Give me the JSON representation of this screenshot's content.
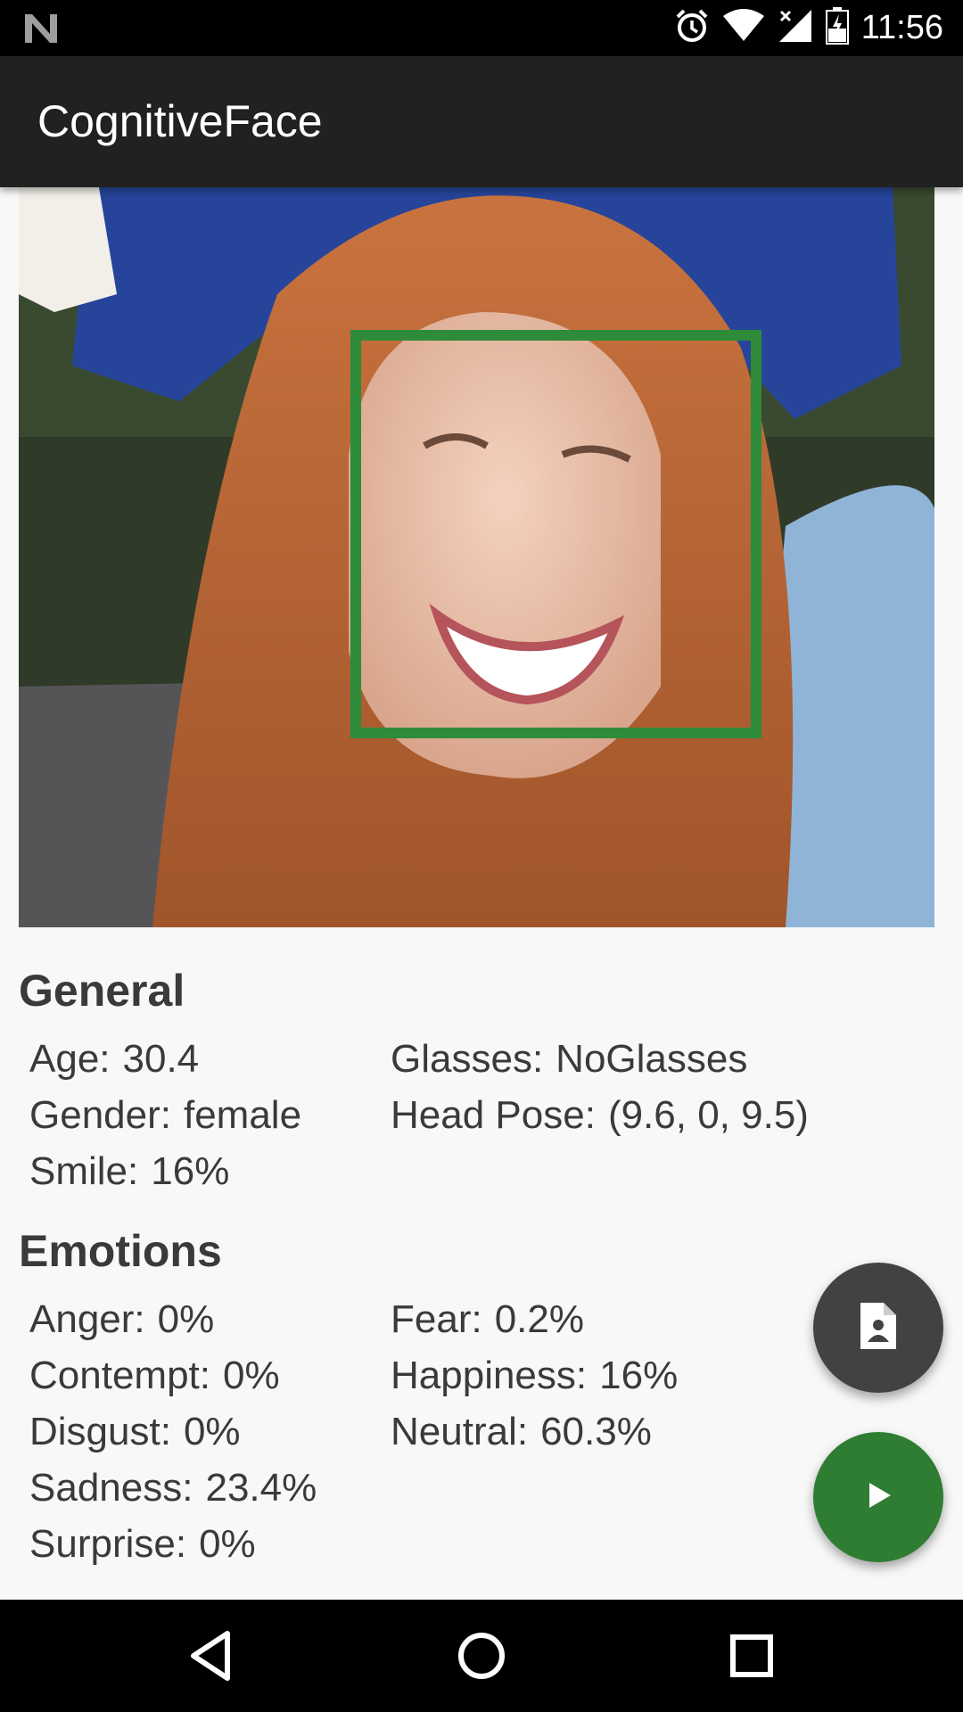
{
  "status_bar": {
    "time": "11:56",
    "icons": [
      "n-notification-icon",
      "alarm-icon",
      "wifi-icon",
      "signal-icon",
      "battery-icon"
    ]
  },
  "app_bar": {
    "title": "CognitiveFace"
  },
  "photo": {
    "description_icon": "face-photo"
  },
  "general": {
    "title": "General",
    "left": [
      {
        "label": "Age:",
        "value": "30.4"
      },
      {
        "label": "Gender:",
        "value": "female"
      },
      {
        "label": "Smile:",
        "value": "16%"
      }
    ],
    "right": [
      {
        "label": "Glasses:",
        "value": "NoGlasses"
      },
      {
        "label": "Head Pose:",
        "value": "(9.6, 0, 9.5)"
      }
    ]
  },
  "emotions": {
    "title": "Emotions",
    "left": [
      {
        "label": "Anger:",
        "value": "0%"
      },
      {
        "label": "Contempt:",
        "value": "0%"
      },
      {
        "label": "Disgust:",
        "value": "0%"
      },
      {
        "label": "Sadness:",
        "value": "23.4%"
      },
      {
        "label": "Surprise:",
        "value": "0%"
      }
    ],
    "right": [
      {
        "label": "Fear:",
        "value": "0.2%"
      },
      {
        "label": "Happiness:",
        "value": "16%"
      },
      {
        "label": "Neutral:",
        "value": "60.3%"
      }
    ]
  },
  "fabs": {
    "pick_image_icon": "image-file-icon",
    "run_icon": "play-icon"
  },
  "colors": {
    "face_box": "#2e8b3a",
    "run_button": "#2e7d32",
    "pick_button": "#424242",
    "app_bar": "#212121"
  }
}
